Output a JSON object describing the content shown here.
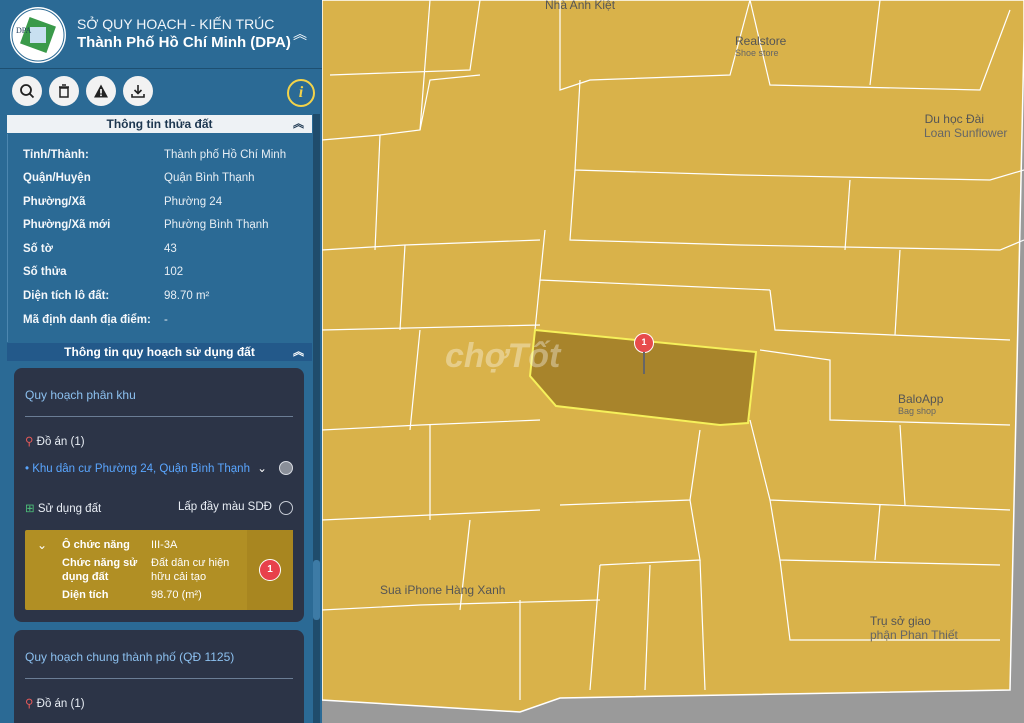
{
  "header": {
    "org_line1": "SỞ QUY HOẠCH - KIẾN TRÚC",
    "org_line2": "Thành Phố Hồ Chí Minh (DPA)",
    "logo_text": "DPA"
  },
  "toolbar": {
    "icons": [
      "search-icon",
      "trash-icon",
      "warning-icon",
      "download-icon",
      "info-icon"
    ],
    "info_label": "i"
  },
  "parcel_info": {
    "title": "Thông tin thửa đất",
    "rows": [
      {
        "label": "Tỉnh/Thành:",
        "value": "Thành phố Hồ Chí Minh"
      },
      {
        "label": "Quận/Huyện",
        "value": "Quận Bình Thạnh"
      },
      {
        "label": "Phường/Xã",
        "value": "Phường 24"
      },
      {
        "label": "Phường/Xã mới",
        "value": "Phường Bình Thạnh"
      },
      {
        "label": "Số tờ",
        "value": "43"
      },
      {
        "label": "Số thửa",
        "value": "102"
      },
      {
        "label": "Diện tích lô đất:",
        "value": "98.70 m²"
      },
      {
        "label": "Mã định danh địa điểm:",
        "value": "-"
      }
    ]
  },
  "land_use": {
    "title": "Thông tin quy hoạch sử dụng đất",
    "zoning": {
      "title": "Quy hoạch phân khu",
      "project_label": "Đồ án (1)",
      "project_name": "Khu dân cư Phường 24, Quận Bình Thạnh",
      "land_use_label": "Sử dụng đất",
      "fill_label": "Lấp đầy màu SDĐ",
      "func_rows": [
        {
          "label": "Ô chức năng",
          "value": "III-3A"
        },
        {
          "label": "Chức năng sử",
          "value": "Đất dân cư hiện"
        },
        {
          "label": "dụng đất",
          "value": "hữu cải tạo"
        },
        {
          "label": "Diện tích",
          "value": "98.70 (m²)"
        }
      ],
      "badge": "1"
    },
    "general": {
      "title": "Quy hoạch chung thành phố (QĐ 1125)",
      "project_label": "Đồ án (1)"
    }
  },
  "map": {
    "pin_label": "1",
    "watermark": "chợTốt",
    "poi": [
      {
        "name": "Nhà Anh Kiệt",
        "sub": ""
      },
      {
        "name": "Realstore",
        "sub": "Shoe store"
      },
      {
        "name": "Du học Đài",
        "sub": "Loan Sunflower"
      },
      {
        "name": "BaloApp",
        "sub": "Bag shop"
      },
      {
        "name": "Sua iPhone Hàng Xanh",
        "sub": ""
      },
      {
        "name": "Trụ sở giao",
        "sub": "phận Phan Thiết"
      }
    ],
    "colors": {
      "land": "#d9b24a",
      "parcel": "#a8842b",
      "parcel_border": "#f6f05a",
      "road": "#9a9a9a"
    }
  }
}
